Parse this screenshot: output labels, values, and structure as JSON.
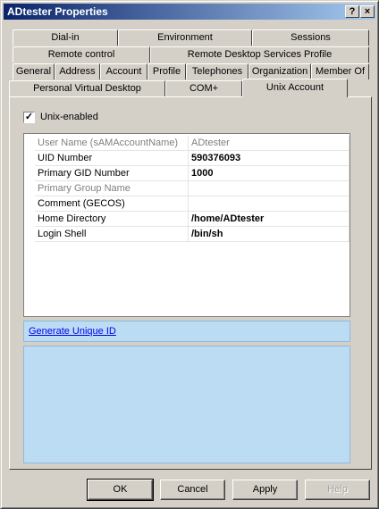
{
  "window": {
    "title": "ADtester Properties",
    "help_glyph": "?",
    "close_glyph": "×"
  },
  "tabs": {
    "row1": [
      "Dial-in",
      "Environment",
      "Sessions"
    ],
    "row2": [
      "Remote control",
      "Remote Desktop Services Profile"
    ],
    "row3": [
      "General",
      "Address",
      "Account",
      "Profile",
      "Telephones",
      "Organization",
      "Member Of"
    ],
    "row4": [
      "Personal Virtual Desktop",
      "COM+",
      "Unix Account"
    ],
    "active": "Unix Account"
  },
  "unix": {
    "checkbox_label": "Unix-enabled",
    "checkbox_checked": true,
    "check_glyph": "✓",
    "rows": [
      {
        "name": "User Name (sAMAccountName)",
        "value": "ADtester",
        "disabled": true
      },
      {
        "name": "UID Number",
        "value": "590376093",
        "disabled": false
      },
      {
        "name": "Primary GID Number",
        "value": "1000",
        "disabled": false
      },
      {
        "name": "Primary Group Name",
        "value": "",
        "disabled": true
      },
      {
        "name": "Comment (GECOS)",
        "value": "",
        "disabled": false
      },
      {
        "name": "Home Directory",
        "value": "/home/ADtester",
        "disabled": false
      },
      {
        "name": "Login Shell",
        "value": "/bin/sh",
        "disabled": false
      }
    ],
    "link_label": "Generate Unique ID"
  },
  "buttons": {
    "ok": "OK",
    "cancel": "Cancel",
    "apply": "Apply",
    "help": "Help"
  }
}
